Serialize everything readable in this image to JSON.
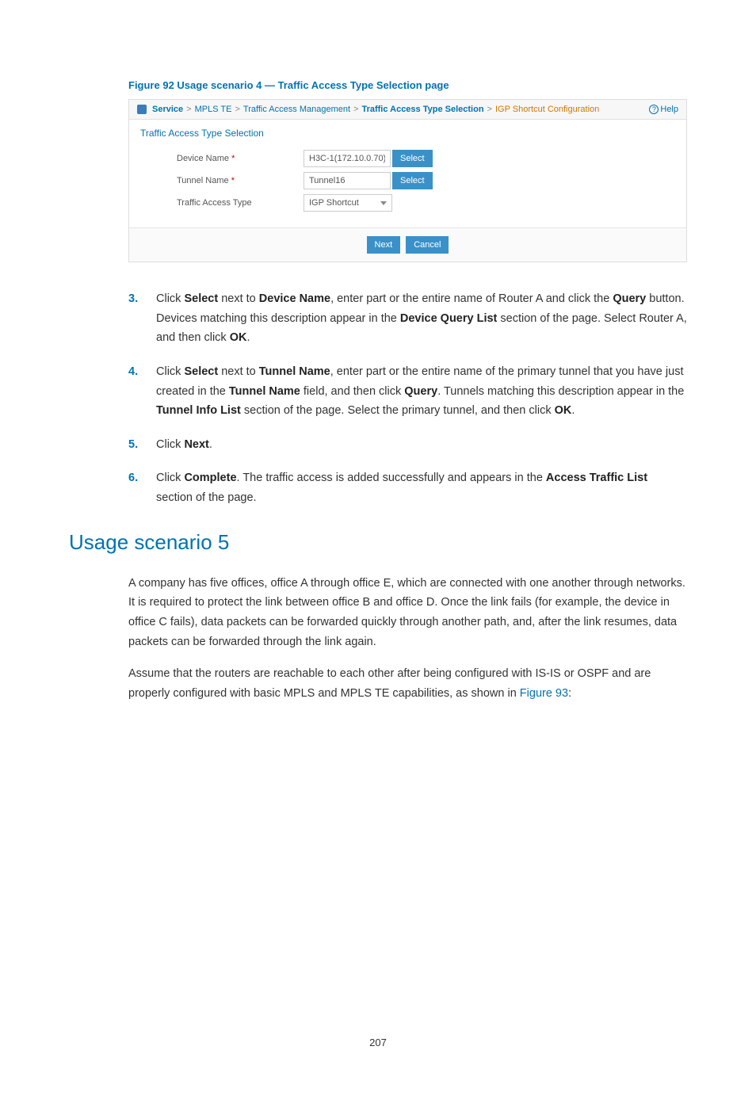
{
  "figure_caption": "Figure 92 Usage scenario 4 — Traffic Access Type Selection page",
  "breadcrumb": {
    "service": "Service",
    "mpls": "MPLS TE",
    "tam": "Traffic Access Management",
    "tats": "Traffic Access Type Selection",
    "igp": "IGP Shortcut Configuration",
    "sep": ">"
  },
  "help_label": "Help",
  "panel_title": "Traffic Access Type Selection",
  "form": {
    "device_label": "Device Name",
    "device_value": "H3C-1(172.10.0.70)",
    "tunnel_label": "Tunnel Name",
    "tunnel_value": "Tunnel16",
    "type_label": "Traffic Access Type",
    "type_value": "IGP Shortcut",
    "select_btn": "Select",
    "required": "*"
  },
  "actions": {
    "next": "Next",
    "cancel": "Cancel"
  },
  "steps": [
    {
      "num": "3.",
      "segments": [
        {
          "t": "Click "
        },
        {
          "b": "Select"
        },
        {
          "t": " next to "
        },
        {
          "b": "Device Name"
        },
        {
          "t": ", enter part or the entire name of Router A and click the "
        },
        {
          "b": "Query"
        },
        {
          "t": " button. Devices matching this description appear in the "
        },
        {
          "b": "Device Query List"
        },
        {
          "t": " section of the page. Select Router A, and then click "
        },
        {
          "b": "OK"
        },
        {
          "t": "."
        }
      ]
    },
    {
      "num": "4.",
      "segments": [
        {
          "t": "Click "
        },
        {
          "b": "Select"
        },
        {
          "t": " next to "
        },
        {
          "b": "Tunnel Name"
        },
        {
          "t": ", enter part or the entire name of the primary tunnel that you have just created in the "
        },
        {
          "b": "Tunnel Name"
        },
        {
          "t": " field, and then click "
        },
        {
          "b": "Query"
        },
        {
          "t": ". Tunnels matching this description appear in the "
        },
        {
          "b": "Tunnel Info List"
        },
        {
          "t": " section of the page. Select the primary tunnel, and then click "
        },
        {
          "b": "OK"
        },
        {
          "t": "."
        }
      ]
    },
    {
      "num": "5.",
      "segments": [
        {
          "t": "Click "
        },
        {
          "b": "Next"
        },
        {
          "t": "."
        }
      ]
    },
    {
      "num": "6.",
      "segments": [
        {
          "t": "Click "
        },
        {
          "b": "Complete"
        },
        {
          "t": ". The traffic access is added successfully and appears in the "
        },
        {
          "b": "Access Traffic List"
        },
        {
          "t": " section of the page."
        }
      ]
    }
  ],
  "section_heading": "Usage scenario 5",
  "para1": "A company has five offices, office A through office E, which are connected with one another through networks. It is required to protect the link between office B and office D. Once the link fails (for example, the device in office C fails), data packets can be forwarded quickly through another path, and, after the link resumes, data packets can be forwarded through the link again.",
  "para2_pre": "Assume that the routers are reachable to each other after being configured with IS-IS or OSPF and are properly configured with basic MPLS and MPLS TE capabilities, as shown in ",
  "para2_link": "Figure 93",
  "para2_post": ":",
  "page_number": "207"
}
